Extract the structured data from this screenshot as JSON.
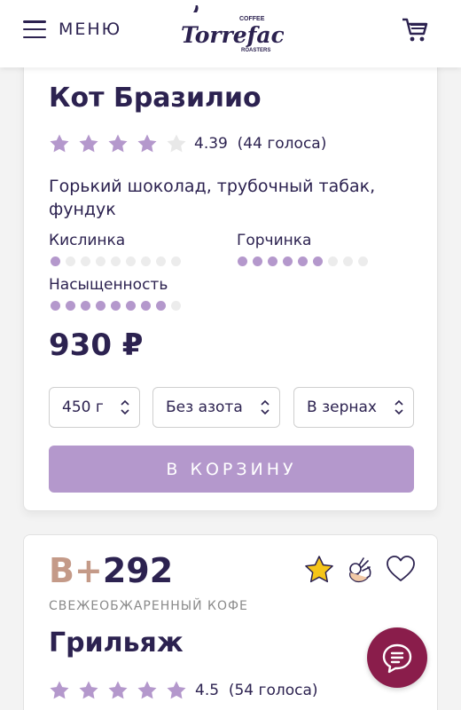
{
  "header": {
    "menu_label": "МЕНЮ",
    "logo_text": "Torrefacto",
    "logo_top": "COFFEE",
    "logo_bottom": "ROASTERS"
  },
  "product1": {
    "title": "Кот Бразилио",
    "rating_value": "4.39",
    "votes": "(44 голоса)",
    "stars_filled": 4,
    "stars_total": 5,
    "description": "Горький шоколад, трубочный табак, фундук",
    "params": [
      {
        "label": "Кислинка",
        "level": 1,
        "max": 9
      },
      {
        "label": "Горчинка",
        "level": 6,
        "max": 9
      },
      {
        "label": "Насыщенность",
        "level": 8,
        "max": 9
      }
    ],
    "price": "930 ₽",
    "selects": {
      "weight": "450 г",
      "nitrogen": "Без азота",
      "grind": "В зернах"
    },
    "cart_button": "В КОРЗИНУ"
  },
  "product2": {
    "badge_b": "В",
    "badge_plus": "+",
    "badge_num": "292",
    "subtitle": "СВЕЖЕОБЖАРЕННЫЙ КОФЕ",
    "title": "Грильяж",
    "rating_value": "4.5",
    "votes": "(54 голоса)",
    "stars_filled": 5,
    "stars_total": 5
  },
  "colors": {
    "accent": "#b498cc",
    "text": "#2c2250",
    "chat": "#8a1d4b",
    "star_empty": "#e8e8e8"
  },
  "icons": [
    "menu-icon",
    "cart-icon",
    "star-icon",
    "ok-hand-icon",
    "heart-icon",
    "chat-icon",
    "select-arrows-icon"
  ]
}
